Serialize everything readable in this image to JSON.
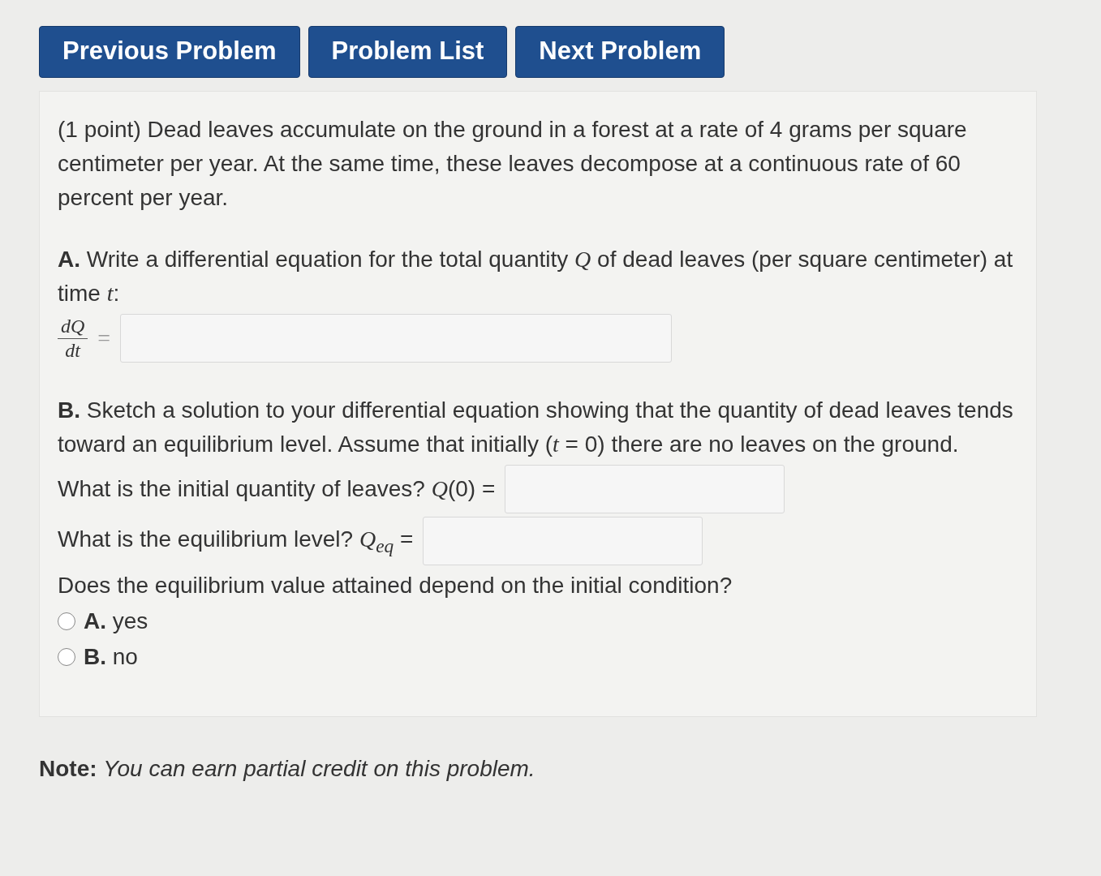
{
  "nav_buttons": [
    {
      "label": "Previous Problem"
    },
    {
      "label": "Problem List"
    },
    {
      "label": "Next Problem"
    }
  ],
  "problem": {
    "intro": "(1 point) Dead leaves accumulate on the ground in a forest at a rate of 4 grams per square centimeter per year. At the same time, these leaves decompose at a continuous rate of 60 percent per year.",
    "part_a": {
      "text": "**A.** Write a differential equation for the total quantity *Q* of dead leaves (per square centimeter) at time *t*:",
      "numerator": "dQ",
      "denominator": "dt",
      "equals": "="
    },
    "part_b": {
      "text": "**B.** Sketch a solution to your differential equation showing that the quantity of dead leaves tends toward an equilibrium level. Assume that initially (*t* = 0) there are no leaves on the ground.",
      "questions": [
        {
          "text": "What is the initial quantity of leaves? *Q*(0) ="
        },
        {
          "text": "What is the equilibrium level? *Q*$_{eq}$ ="
        }
      ],
      "choice": {
        "text": "Does the equilibrium value attained depend on the initial condition?",
        "options": [
          {
            "label": "**A.** yes",
            "selected": false
          },
          {
            "label": "**B.** no",
            "selected": false
          }
        ]
      }
    }
  },
  "note": "**Note:** *You can earn partial credit on this problem.*"
}
